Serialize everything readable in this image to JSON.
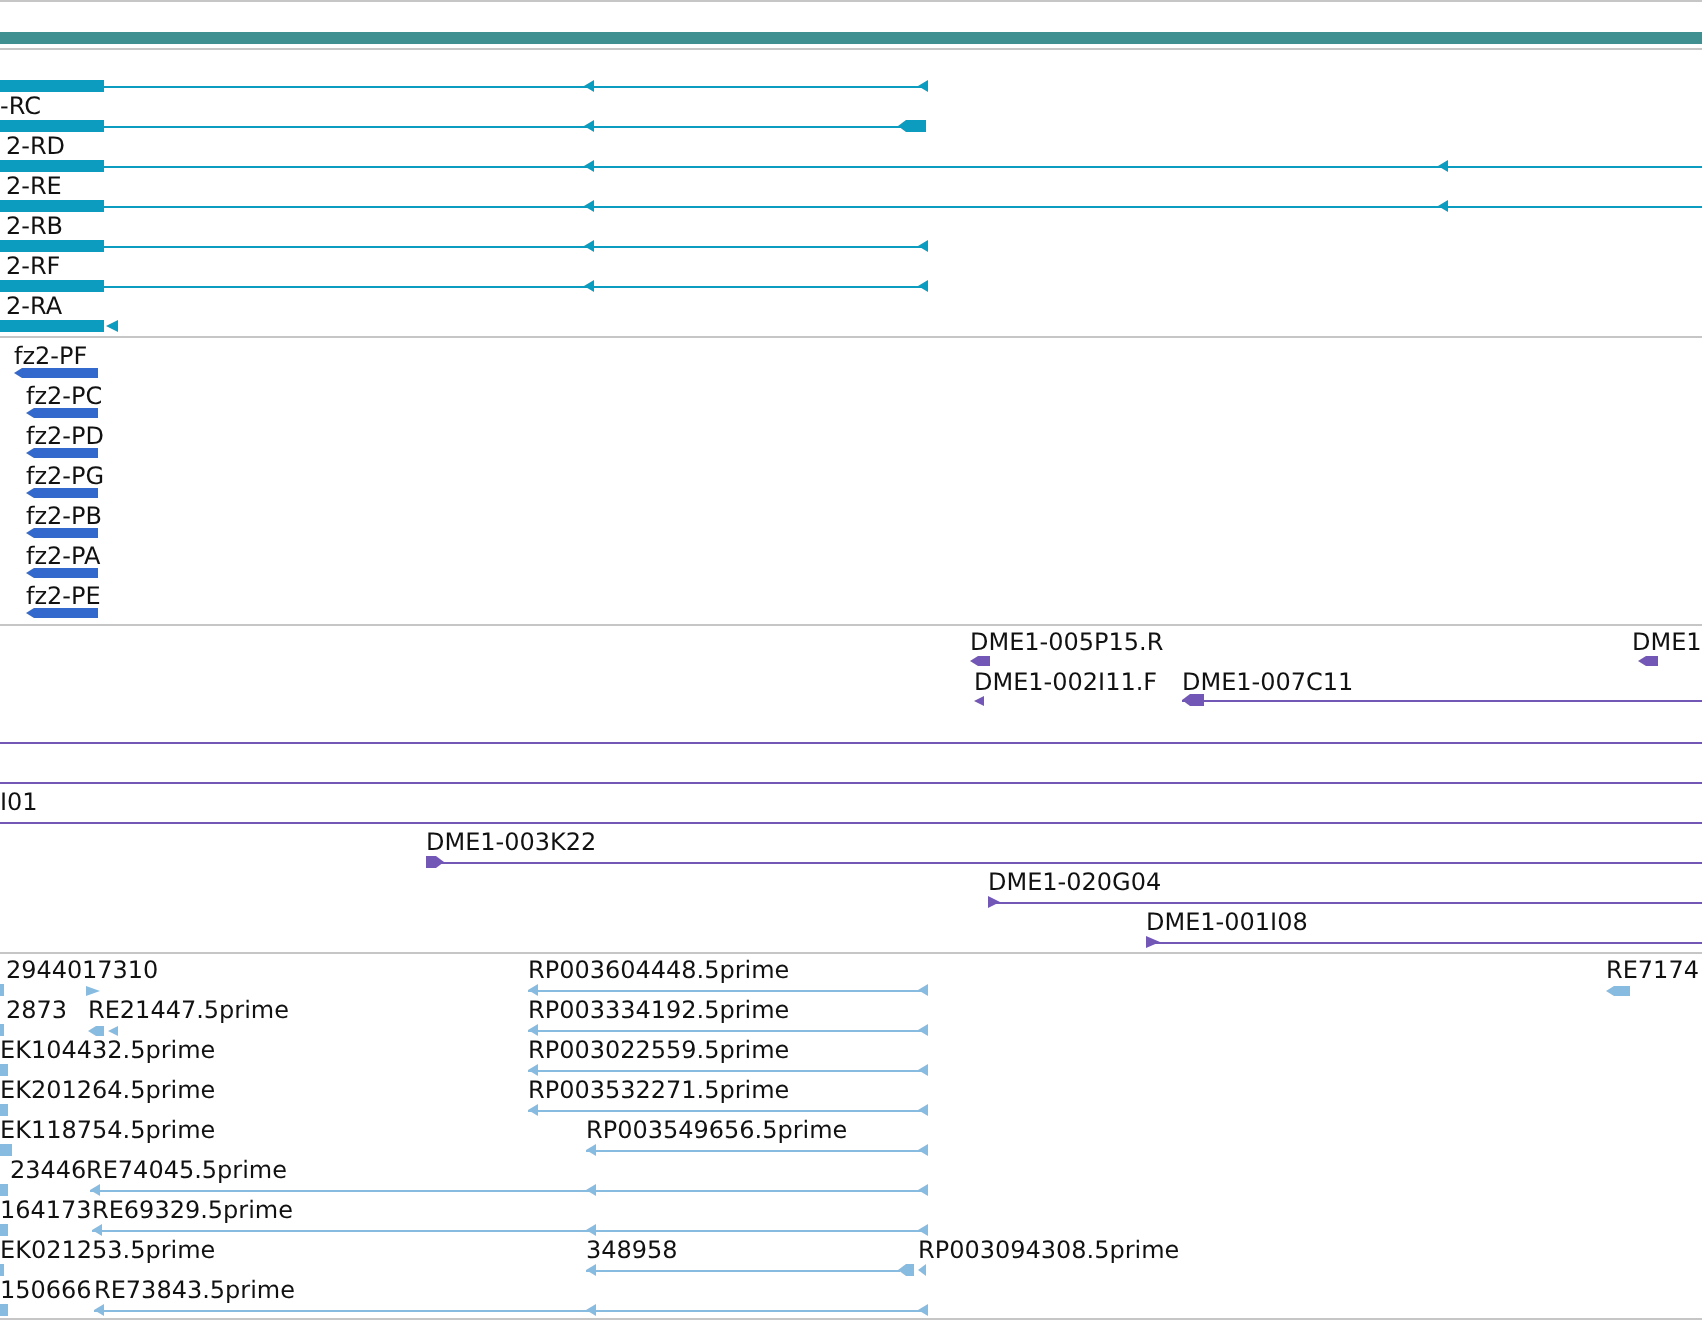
{
  "tracks": [
    {
      "kind": "transcripts",
      "labels": [
        "-RC",
        "2-RD",
        "2-RE",
        "2-RB",
        "2-RF",
        "2-RA"
      ]
    },
    {
      "kind": "proteins",
      "labels": [
        "fz2-PF",
        "fz2-PC",
        "fz2-PD",
        "fz2-PG",
        "fz2-PB",
        "fz2-PA",
        "fz2-PE"
      ]
    },
    {
      "kind": "clones",
      "labels": [
        "DME1-005P15.R",
        "DME1",
        "DME1-002I11.F",
        "DME1-007C11",
        "I01",
        "DME1-003K22",
        "DME1-020G04",
        "DME1-001I08"
      ]
    },
    {
      "kind": "ests",
      "labels": [
        "29440",
        "17310",
        "RP003604448.5prime",
        "RE7174",
        "2873",
        "RE21447.5prime",
        "RP003334192.5prime",
        "EK104432.5prime",
        "RP003022559.5prime",
        "EK201264.5prime",
        "RP003532271.5prime",
        "EK118754.5prime",
        "RP003549656.5prime",
        "23446",
        "RE74045.5prime",
        "164173",
        "RE69329.5prime",
        "EK021253.5prime",
        "348958",
        "RP003094308.5prime",
        "150666",
        "RE73843.5prime"
      ]
    }
  ]
}
